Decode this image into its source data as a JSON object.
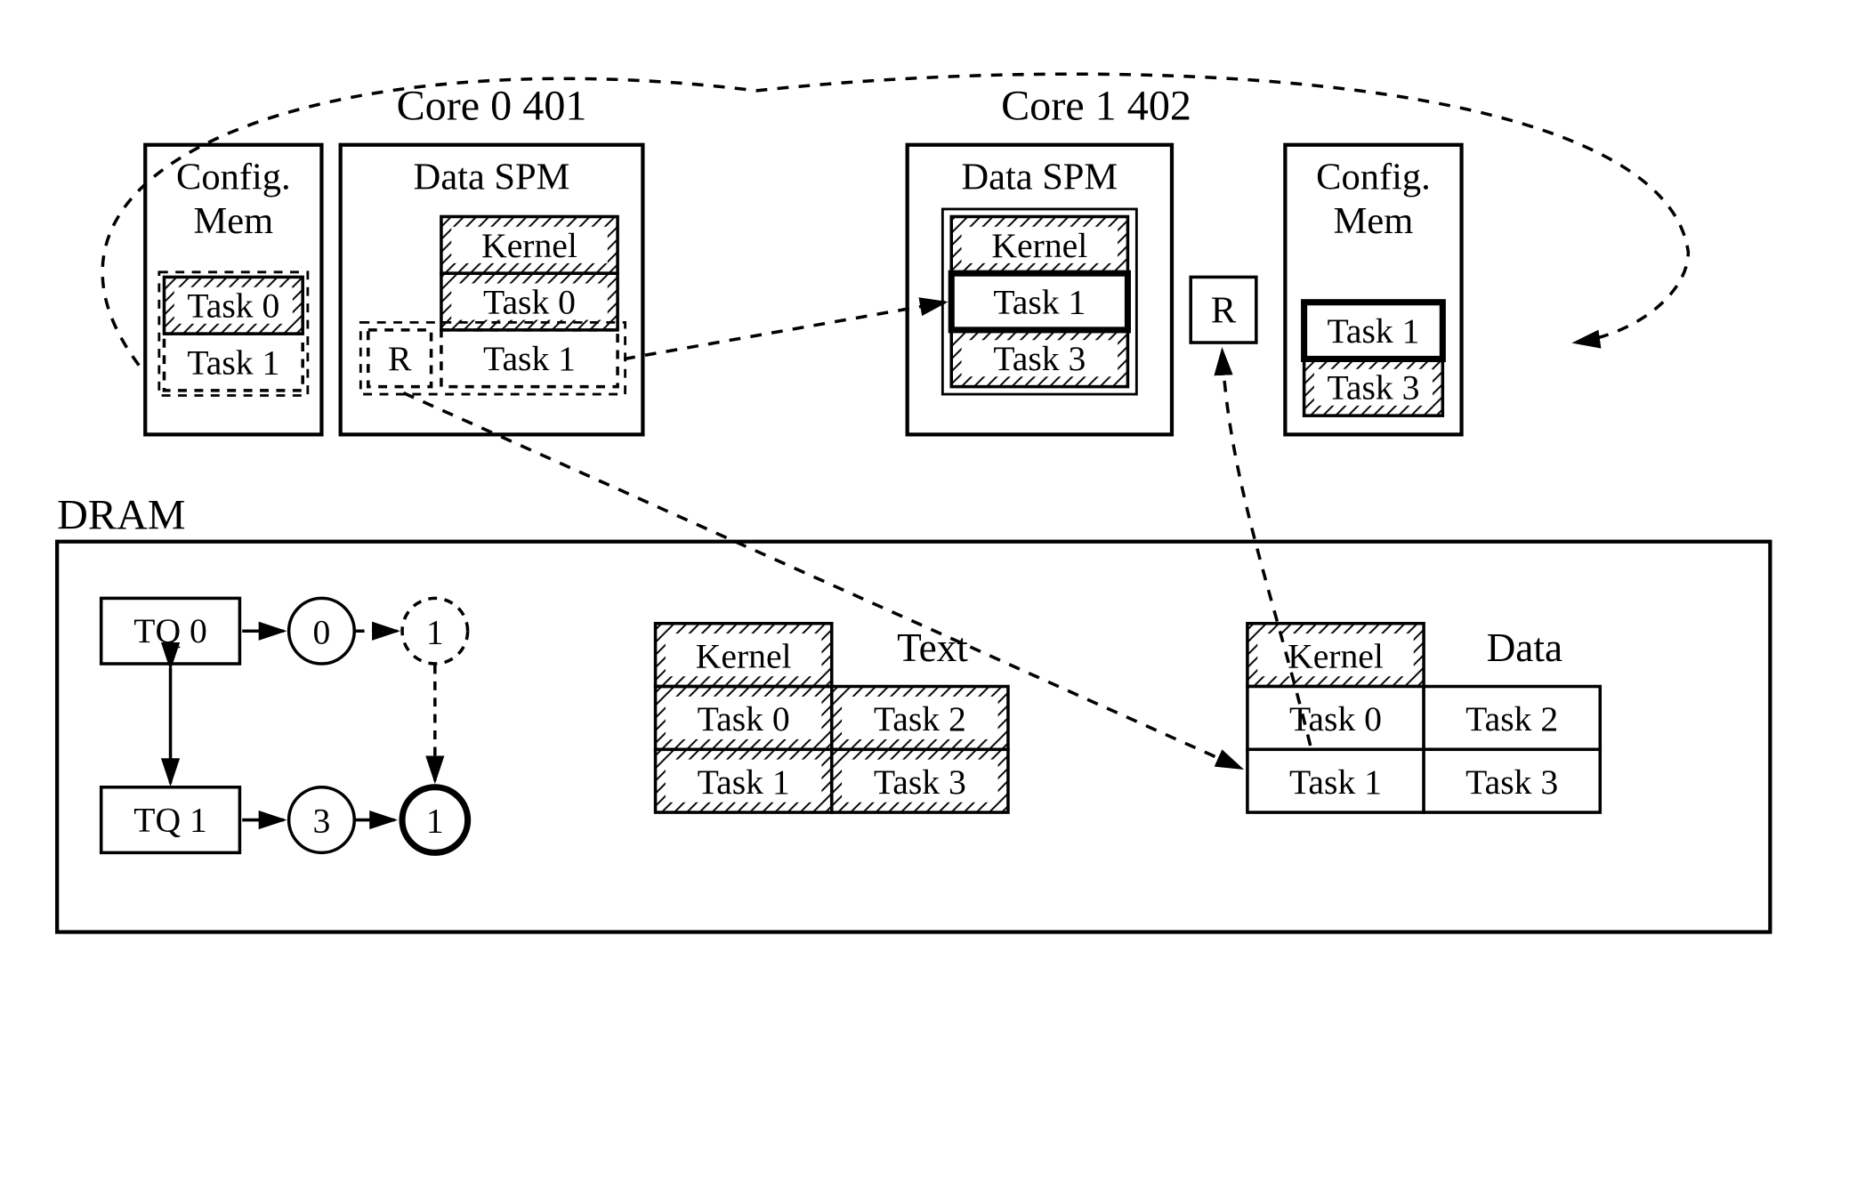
{
  "top": {
    "core0_title": "Core 0 401",
    "core1_title": "Core 1 402",
    "config_mem_label": "Config.\nMem",
    "data_spm_label": "Data SPM",
    "core0": {
      "config_mem_items": [
        "Task 0",
        "Task 1"
      ],
      "data_spm_items": [
        "Kernel",
        "Task 0",
        "Task 1"
      ],
      "r_label": "R"
    },
    "core1": {
      "data_spm_items": [
        "Kernel",
        "Task 1",
        "Task 3"
      ],
      "r_label": "R",
      "config_mem_items": [
        "Task 1",
        "Task 3"
      ]
    }
  },
  "dram": {
    "label": "DRAM",
    "tq0": "TQ 0",
    "tq1": "TQ 1",
    "node0": "0",
    "node1a": "1",
    "node3": "3",
    "node1b": "1",
    "text_section": {
      "title": "Text",
      "cells": [
        "Kernel",
        "Task 0",
        "Task 2",
        "Task 1",
        "Task 3"
      ]
    },
    "data_section": {
      "title": "Data",
      "cells": [
        "Kernel",
        "Task 0",
        "Task 2",
        "Task 1",
        "Task 3"
      ]
    }
  }
}
